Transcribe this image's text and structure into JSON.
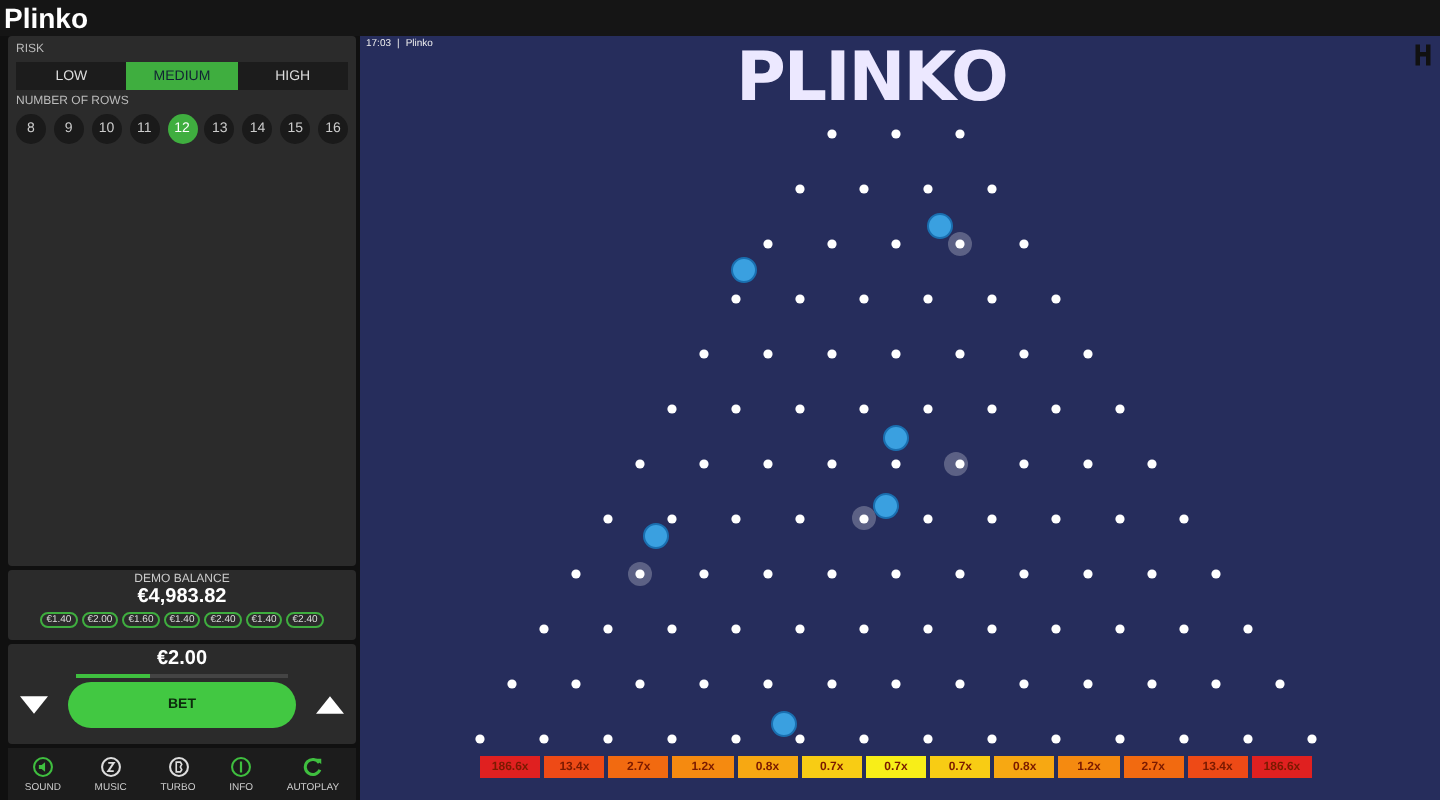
{
  "window": {
    "title": "Plinko"
  },
  "risk": {
    "label": "RISK",
    "options": [
      {
        "label": "LOW",
        "selected": false
      },
      {
        "label": "MEDIUM",
        "selected": true
      },
      {
        "label": "HIGH",
        "selected": false
      }
    ]
  },
  "rows": {
    "label": "NUMBER OF ROWS",
    "options": [
      {
        "label": "8",
        "selected": false
      },
      {
        "label": "9",
        "selected": false
      },
      {
        "label": "10",
        "selected": false
      },
      {
        "label": "11",
        "selected": false
      },
      {
        "label": "12",
        "selected": true
      },
      {
        "label": "13",
        "selected": false
      },
      {
        "label": "14",
        "selected": false
      },
      {
        "label": "15",
        "selected": false
      },
      {
        "label": "16",
        "selected": false
      }
    ]
  },
  "balance": {
    "label": "DEMO BALANCE",
    "value": "€4,983.82",
    "history": [
      "€1.40",
      "€2.00",
      "€1.60",
      "€1.40",
      "€2.40",
      "€1.40",
      "€2.40"
    ]
  },
  "bet": {
    "amount": "€2.00",
    "level": 0.35,
    "button": "BET"
  },
  "toolbar": [
    {
      "label": "SOUND",
      "kind": "sound"
    },
    {
      "label": "MUSIC",
      "kind": "music"
    },
    {
      "label": "TURBO",
      "kind": "turbo"
    },
    {
      "label": "INFO",
      "kind": "info"
    },
    {
      "label": "AUTOPLAY",
      "kind": "autoplay"
    }
  ],
  "game": {
    "clock": "17:03",
    "separator": "|",
    "name": "Plinko",
    "logo": "PLINKO",
    "slots": [
      {
        "label": "186.6x",
        "color": "#e02020"
      },
      {
        "label": "13.4x",
        "color": "#ee4a16"
      },
      {
        "label": "2.7x",
        "color": "#f26a10"
      },
      {
        "label": "1.2x",
        "color": "#f58a10"
      },
      {
        "label": "0.8x",
        "color": "#f7a812"
      },
      {
        "label": "0.7x",
        "color": "#f8cc14"
      },
      {
        "label": "0.7x",
        "color": "#f8ee18"
      },
      {
        "label": "0.7x",
        "color": "#f8cc14"
      },
      {
        "label": "0.8x",
        "color": "#f7a812"
      },
      {
        "label": "1.2x",
        "color": "#f58a10"
      },
      {
        "label": "2.7x",
        "color": "#f26a10"
      },
      {
        "label": "13.4x",
        "color": "#ee4a16"
      },
      {
        "label": "186.6x",
        "color": "#e02020"
      }
    ]
  }
}
